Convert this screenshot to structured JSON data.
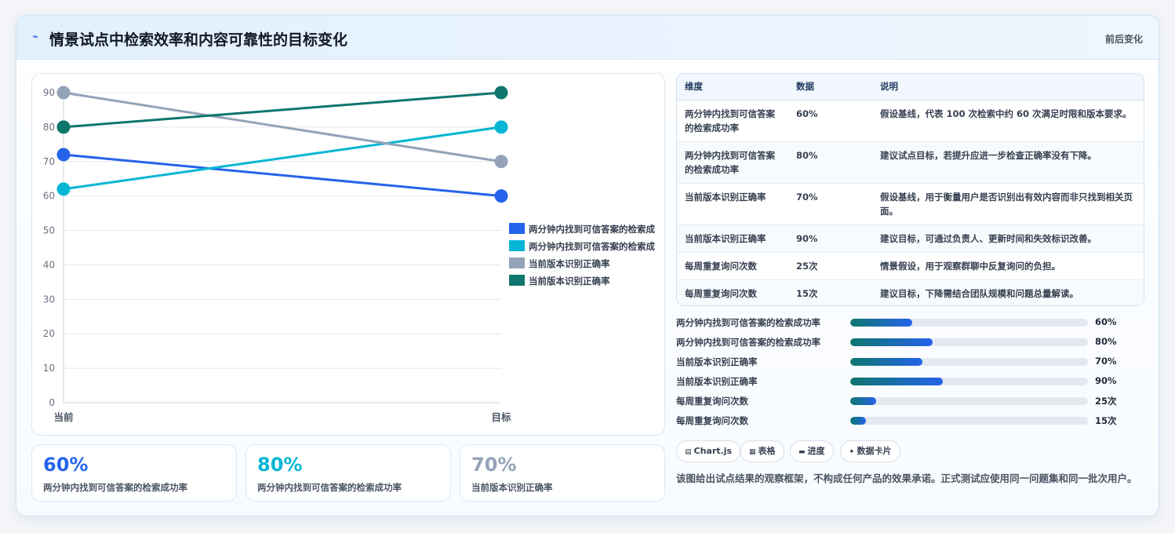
{
  "header": {
    "icon": "lightning-icon",
    "title": "情景试点中检索效率和内容可靠性的目标变化",
    "tag": "前后变化"
  },
  "chart_data": {
    "type": "line",
    "x": [
      "当前",
      "目标"
    ],
    "ylim": [
      0,
      90
    ],
    "yticks": [
      0,
      10,
      20,
      30,
      40,
      50,
      60,
      70,
      80,
      90
    ],
    "legend_position": "right",
    "grid": true,
    "series": [
      {
        "name": "两分钟内找到可信答案的检索成功率",
        "legend_label": "两分钟内找到可信答案的检索成",
        "color": "#2563eb",
        "values": [
          72,
          60
        ]
      },
      {
        "name": "两分钟内找到可信答案的检索成功率",
        "legend_label": "两分钟内找到可信答案的检索成",
        "color": "#06b6d4",
        "values": [
          62,
          80
        ]
      },
      {
        "name": "当前版本识别正确率",
        "legend_label": "当前版本识别正确率",
        "color": "#94a3b8",
        "values": [
          90,
          70
        ]
      },
      {
        "name": "当前版本识别正确率",
        "legend_label": "当前版本识别正确率",
        "color": "#0f766e",
        "values": [
          80,
          90
        ]
      }
    ]
  },
  "stats": [
    {
      "value": "60%",
      "label": "两分钟内找到可信答案的检索成功率",
      "color": "#2563eb"
    },
    {
      "value": "80%",
      "label": "两分钟内找到可信答案的检索成功率",
      "color": "#06b6d4"
    },
    {
      "value": "70%",
      "label": "当前版本识别正确率",
      "color": "#94a3b8"
    }
  ],
  "table": {
    "headers": [
      "维度",
      "数据",
      "说明"
    ],
    "rows": [
      {
        "dimension": "两分钟内找到可信答案的检索成功率",
        "data": "60%",
        "note": "假设基线，代表 100 次检索中约 60 次满足时限和版本要求。"
      },
      {
        "dimension": "两分钟内找到可信答案的检索成功率",
        "data": "80%",
        "note": "建议试点目标，若提升应进一步检查正确率没有下降。"
      },
      {
        "dimension": "当前版本识别正确率",
        "data": "70%",
        "note": "假设基线，用于衡量用户是否识别出有效内容而非只找到相关页面。"
      },
      {
        "dimension": "当前版本识别正确率",
        "data": "90%",
        "note": "建议目标，可通过负责人、更新时间和失效标识改善。"
      },
      {
        "dimension": "每周重复询问次数",
        "data": "25次",
        "note": "情景假设，用于观察群聊中反复询问的负担。"
      },
      {
        "dimension": "每周重复询问次数",
        "data": "15次",
        "note": "建议目标，下降需结合团队规模和问题总量解读。"
      }
    ]
  },
  "progress": [
    {
      "label": "两分钟内找到可信答案的检索成功率",
      "value": "60%",
      "fraction": 0.26
    },
    {
      "label": "两分钟内找到可信答案的检索成功率",
      "value": "80%",
      "fraction": 0.346
    },
    {
      "label": "当前版本识别正确率",
      "value": "70%",
      "fraction": 0.303
    },
    {
      "label": "当前版本识别正确率",
      "value": "90%",
      "fraction": 0.39
    },
    {
      "label": "每周重复询问次数",
      "value": "25次",
      "fraction": 0.108
    },
    {
      "label": "每周重复询问次数",
      "value": "15次",
      "fraction": 0.065
    }
  ],
  "chips": [
    {
      "icon": "chart-icon",
      "glyph": "▤",
      "label": "Chart.js"
    },
    {
      "icon": "table-icon",
      "glyph": "▦",
      "label": "表格"
    },
    {
      "icon": "progress-icon",
      "glyph": "▬",
      "label": "进度"
    },
    {
      "icon": "sparkle-icon",
      "glyph": "✦",
      "label": "数据卡片"
    }
  ],
  "note": "该图给出试点结果的观察框架，不构成任何产品的效果承诺。正式测试应使用同一问题集和同一批次用户。"
}
